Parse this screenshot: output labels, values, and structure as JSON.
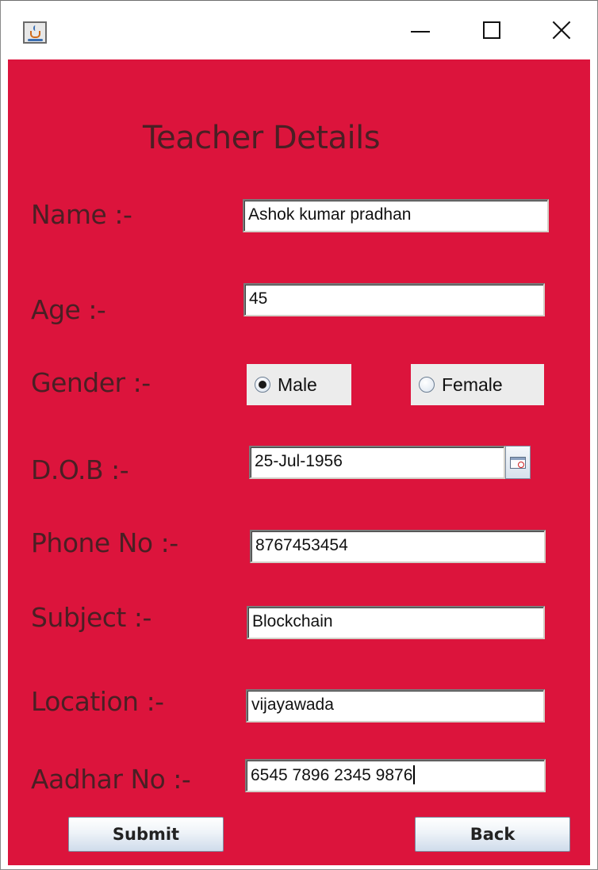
{
  "window": {
    "title": "",
    "app_icon": "java-icon",
    "controls": {
      "minimize_icon": "minimize-icon",
      "maximize_icon": "maximize-icon",
      "close_icon": "close-icon"
    }
  },
  "form": {
    "background_color": "#dc143c",
    "label_color": "#4a1f24",
    "heading": "Teacher Details",
    "name": {
      "label": "Name :-",
      "value": "Ashok kumar pradhan"
    },
    "age": {
      "label": "Age :-",
      "value": "45"
    },
    "gender": {
      "label": "Gender :-",
      "options": [
        "Male",
        "Female"
      ],
      "selected": "Male"
    },
    "dob": {
      "label": "D.O.B :-",
      "value": "25-Jul-1956",
      "picker_icon": "calendar-icon"
    },
    "phone": {
      "label": "Phone No :-",
      "value": "8767453454"
    },
    "subject": {
      "label": "Subject :-",
      "value": "Blockchain"
    },
    "location": {
      "label": "Location :-",
      "value": "vijayawada"
    },
    "aadhar": {
      "label": "Aadhar No :-",
      "value": "6545 7896 2345 9876"
    },
    "buttons": {
      "submit": "Submit",
      "back": "Back"
    }
  }
}
